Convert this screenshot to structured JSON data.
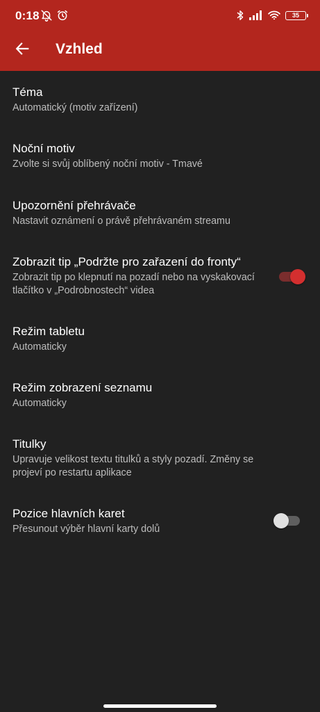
{
  "status_bar": {
    "time": "0:18",
    "battery": "35",
    "left_icons": [
      "bell-off-icon",
      "alarm-clock-icon"
    ],
    "right_icons": [
      "bluetooth-icon",
      "signal-icon",
      "wifi-icon",
      "battery-icon"
    ]
  },
  "app_bar": {
    "title": "Vzhled",
    "back_icon": "arrow-back-icon",
    "color": "#b3261e"
  },
  "colors": {
    "background": "#212121",
    "accent": "#d32f2f",
    "summary_text": "#bdbdbd"
  },
  "settings": [
    {
      "title": "Téma",
      "summary": "Automatický (motiv zařízení)"
    },
    {
      "title": "Noční motiv",
      "summary": "Zvolte si svůj oblíbený noční motiv - Tmavé"
    },
    {
      "title": "Upozornění přehrávače",
      "summary": "Nastavit oznámení o právě přehrávaném streamu"
    },
    {
      "title": "Zobrazit tip „Podržte pro zařazení do fronty“",
      "summary": "Zobrazit tip po klepnutí na pozadí nebo na vyskakovací tlačítko v „Podrobnostech“ videa",
      "switch_on": true
    },
    {
      "title": "Režim tabletu",
      "summary": "Automaticky"
    },
    {
      "title": "Režim zobrazení seznamu",
      "summary": "Automaticky"
    },
    {
      "title": "Titulky",
      "summary": "Upravuje velikost textu titulků a styly pozadí. Změny se projeví po restartu aplikace"
    },
    {
      "title": "Pozice hlavních karet",
      "summary": "Přesunout výběr hlavní karty dolů",
      "switch_on": false
    }
  ]
}
